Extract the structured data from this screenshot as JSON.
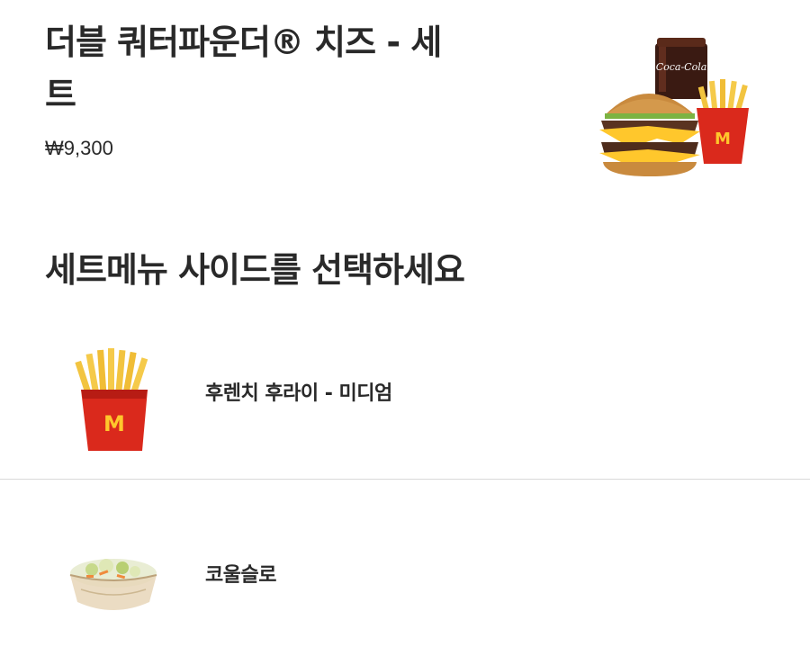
{
  "product": {
    "title": "더블 쿼터파운더® 치즈 - 세트",
    "price": "₩9,300",
    "image_icon": "double-quarter-pounder-set-image"
  },
  "section": {
    "title": "세트메뉴 사이드를 선택하세요"
  },
  "sides": [
    {
      "label": "후렌치 후라이 - 미디엄",
      "icon": "french-fries-image"
    },
    {
      "label": "코울슬로",
      "icon": "coleslaw-image"
    }
  ],
  "colors": {
    "text": "#292929",
    "divider": "#d9d9d9",
    "brand_red": "#da291c",
    "brand_yellow": "#ffc72c"
  }
}
